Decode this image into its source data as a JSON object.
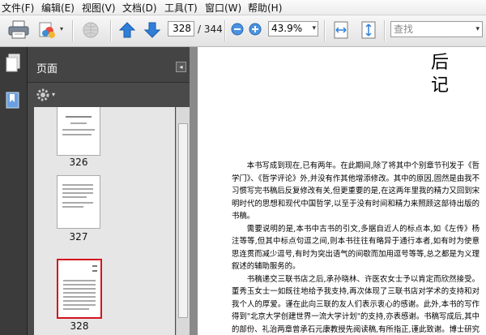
{
  "menu": [
    "文件(F)",
    "编辑(E)",
    "视图(V)",
    "文档(D)",
    "工具(T)",
    "窗口(W)",
    "帮助(H)"
  ],
  "toolbar": {
    "current_page": "328",
    "page_total": "/ 344",
    "zoom": "43.9%",
    "search_placeholder": "查找"
  },
  "panel": {
    "title": "页面",
    "thumbnails": [
      {
        "label": "326",
        "selected": false
      },
      {
        "label": "327",
        "selected": false
      },
      {
        "label": "328",
        "selected": true
      }
    ]
  },
  "document": {
    "heading_line1": "后",
    "heading_line2": "记",
    "paragraphs": [
      "本书写成到现在,已有两年。在此期间,除了将其中个别章节刊发于《哲学门》、《哲学评论》外,并没有作其他增添修改。其中的原因,固然是由我不习惯写完书稿后反复修改有关,但更重要的是,在这两年里我的精力又回到宋明时代的思想和现代中国哲学,以至于没有时间和精力来照顾这部待出版的书稿。",
      "需要说明的是,本书中古书的引文,多据自近人的标点本,如《左传》杨注等等,但其中标点句逗之间,则本书往往有略异于通行本者,如有时为使意思连贯而减少逗号,有时为突出语气的间歇而加用逗号等等,总之都是为义理叙述的辅助服务的。",
      "书稿递交三联书店之后,承孙晓林、许医农女士予以肯定而欣然接受。董秀玉女士一如既往地给予我支持,再次体现了三联书店对学术的支持和对我个人的厚爱。谨在此向三联的友人们表示衷心的感谢。此外,本书的写作得到\"北京大学创建世界一流大学计划\"的支持,亦表感谢。书稿写成后,其中的部份、礼治两章曾承石元康教授先阅读稿,有所指正,谨此致谢。博士研究生刘听说、蔡世昌、张丽华核对书稿引文、认真细致,在一并致谢。"
    ]
  },
  "colors": {
    "panel_bg": "#4a4a4a",
    "nav_strip": "#3b3b3b",
    "selected_thumb_border": "#d4141c",
    "arrow_blue": "#2f7fd8"
  }
}
